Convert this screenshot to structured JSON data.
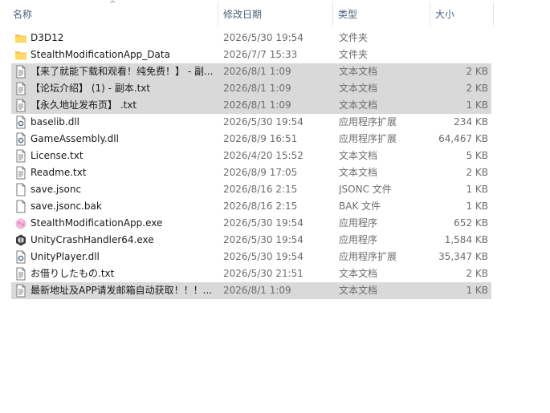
{
  "columns": {
    "name": "名称",
    "date": "修改日期",
    "type": "类型",
    "size": "大小"
  },
  "rows": [
    {
      "name": "D3D12",
      "date": "2026/5/30 19:54",
      "type": "文件夹",
      "size": "",
      "icon": "folder-icon",
      "selected": false
    },
    {
      "name": "StealthModificationApp_Data",
      "date": "2026/7/7 15:33",
      "type": "文件夹",
      "size": "",
      "icon": "folder-icon",
      "selected": false
    },
    {
      "name": "【来了就能下载和观看！纯免费！】 - 副...",
      "date": "2026/8/1 1:09",
      "type": "文本文档",
      "size": "2 KB",
      "icon": "text-file-icon",
      "selected": true
    },
    {
      "name": "【论坛介绍】 (1) - 副本.txt",
      "date": "2026/8/1 1:09",
      "type": "文本文档",
      "size": "2 KB",
      "icon": "text-file-icon",
      "selected": true
    },
    {
      "name": "【永久地址发布页】 .txt",
      "date": "2026/8/1 1:09",
      "type": "文本文档",
      "size": "1 KB",
      "icon": "text-file-icon",
      "selected": true
    },
    {
      "name": "baselib.dll",
      "date": "2026/5/30 19:54",
      "type": "应用程序扩展",
      "size": "234 KB",
      "icon": "dll-file-icon",
      "selected": false
    },
    {
      "name": "GameAssembly.dll",
      "date": "2026/8/9 16:51",
      "type": "应用程序扩展",
      "size": "64,467 KB",
      "icon": "dll-file-icon",
      "selected": false
    },
    {
      "name": "License.txt",
      "date": "2026/4/20 15:52",
      "type": "文本文档",
      "size": "5 KB",
      "icon": "text-file-icon",
      "selected": false
    },
    {
      "name": "Readme.txt",
      "date": "2026/8/9 17:05",
      "type": "文本文档",
      "size": "2 KB",
      "icon": "text-file-icon",
      "selected": false
    },
    {
      "name": "save.jsonc",
      "date": "2026/8/16 2:15",
      "type": "JSONC 文件",
      "size": "1 KB",
      "icon": "blank-file-icon",
      "selected": false
    },
    {
      "name": "save.jsonc.bak",
      "date": "2026/8/16 2:15",
      "type": "BAK 文件",
      "size": "1 KB",
      "icon": "blank-file-icon",
      "selected": false
    },
    {
      "name": "StealthModificationApp.exe",
      "date": "2026/5/30 19:54",
      "type": "应用程序",
      "size": "652 KB",
      "icon": "pink-app-icon",
      "selected": false
    },
    {
      "name": "UnityCrashHandler64.exe",
      "date": "2026/5/30 19:54",
      "type": "应用程序",
      "size": "1,584 KB",
      "icon": "unity-icon",
      "selected": false
    },
    {
      "name": "UnityPlayer.dll",
      "date": "2026/5/30 19:54",
      "type": "应用程序扩展",
      "size": "35,347 KB",
      "icon": "dll-file-icon",
      "selected": false
    },
    {
      "name": "お借りしたもの.txt",
      "date": "2026/5/30 21:51",
      "type": "文本文档",
      "size": "2 KB",
      "icon": "text-file-icon",
      "selected": false
    },
    {
      "name": "最新地址及APP请发邮箱自动获取！！！...",
      "date": "2026/8/1 1:09",
      "type": "文本文档",
      "size": "1 KB",
      "icon": "text-file-icon",
      "selected": true
    }
  ]
}
